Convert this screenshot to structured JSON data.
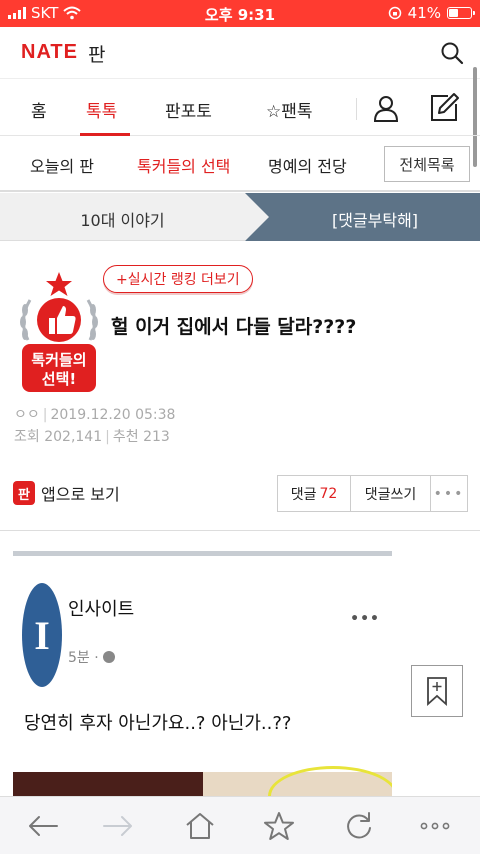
{
  "status": {
    "carrier": "SKT",
    "time": "오후 9:31",
    "battery": "41%",
    "battery_level": 0.41
  },
  "header": {
    "logo": "NATE",
    "section": "판"
  },
  "tabs": [
    {
      "label": "홈"
    },
    {
      "label": "톡톡"
    },
    {
      "label": "판포토"
    },
    {
      "label": "☆팬톡"
    }
  ],
  "subnav": {
    "items": [
      "오늘의 판",
      "톡커들의 선택",
      "명예의 전당"
    ],
    "all_label": "전체목록"
  },
  "topic": {
    "left": "10대 이야기",
    "right": "[댓글부탁해]"
  },
  "post": {
    "badge_text_1": "톡커들의",
    "badge_text_2": "선택!",
    "rank_pill": "+실시간 랭킹 더보기",
    "title": "헐 이거 집에서 다들 달라????",
    "author": "ㅇㅇ",
    "date": "2019.12.20 05:38",
    "views_label": "조회",
    "views": "202,141",
    "recommend_label": "추천",
    "recommend": "213"
  },
  "actions": {
    "app_view": "앱으로 보기",
    "app_icon": "판",
    "comment_label": "댓글",
    "comment_count": "72",
    "write_comment": "댓글쓰기",
    "more": "•••"
  },
  "embed": {
    "avatar_letter": "I",
    "name": "인사이트",
    "time": "5분 ·",
    "dots": "•••",
    "text": "당연히 후자 아닌가요..? 아닌가..??"
  },
  "colors": {
    "accent": "#e02020",
    "topic_active": "#5d7387"
  },
  "icons": [
    "search-icon",
    "user-icon",
    "write-icon",
    "bookmark-add-icon",
    "back-icon",
    "forward-icon",
    "home-icon",
    "star-icon",
    "reload-icon",
    "more-icon"
  ]
}
